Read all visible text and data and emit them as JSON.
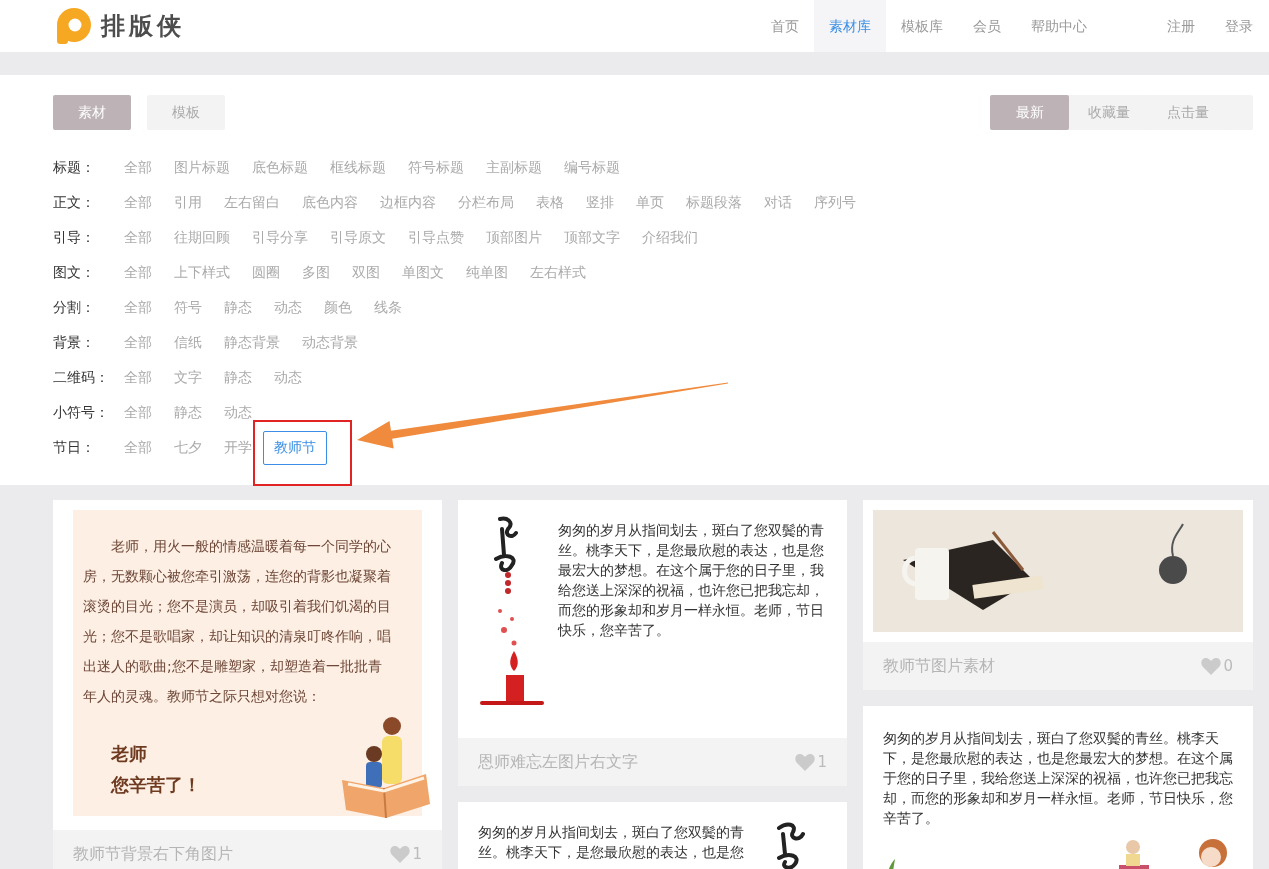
{
  "header": {
    "logo_text": "排版侠",
    "nav": [
      {
        "label": "首页",
        "selected": false
      },
      {
        "label": "素材库",
        "selected": true
      },
      {
        "label": "模板库",
        "selected": false
      },
      {
        "label": "会员",
        "selected": false
      },
      {
        "label": "帮助中心",
        "selected": false
      }
    ],
    "account_links": [
      "注册",
      "登录"
    ]
  },
  "type_tabs": [
    {
      "label": "素材",
      "selected": true
    },
    {
      "label": "模板",
      "selected": false
    }
  ],
  "sort_tabs": [
    {
      "label": "最新",
      "selected": true
    },
    {
      "label": "收藏量",
      "selected": false
    },
    {
      "label": "点击量",
      "selected": false
    }
  ],
  "filters": [
    {
      "label": "标题：",
      "options": [
        {
          "label": "全部",
          "selected": false
        },
        {
          "label": "图片标题",
          "selected": false
        },
        {
          "label": "底色标题",
          "selected": false
        },
        {
          "label": "框线标题",
          "selected": false
        },
        {
          "label": "符号标题",
          "selected": false
        },
        {
          "label": "主副标题",
          "selected": false
        },
        {
          "label": "编号标题",
          "selected": false
        }
      ]
    },
    {
      "label": "正文：",
      "options": [
        {
          "label": "全部",
          "selected": false
        },
        {
          "label": "引用",
          "selected": false
        },
        {
          "label": "左右留白",
          "selected": false
        },
        {
          "label": "底色内容",
          "selected": false
        },
        {
          "label": "边框内容",
          "selected": false
        },
        {
          "label": "分栏布局",
          "selected": false
        },
        {
          "label": "表格",
          "selected": false
        },
        {
          "label": "竖排",
          "selected": false
        },
        {
          "label": "单页",
          "selected": false
        },
        {
          "label": "标题段落",
          "selected": false
        },
        {
          "label": "对话",
          "selected": false
        },
        {
          "label": "序列号",
          "selected": false
        }
      ]
    },
    {
      "label": "引导：",
      "options": [
        {
          "label": "全部",
          "selected": false
        },
        {
          "label": "往期回顾",
          "selected": false
        },
        {
          "label": "引导分享",
          "selected": false
        },
        {
          "label": "引导原文",
          "selected": false
        },
        {
          "label": "引导点赞",
          "selected": false
        },
        {
          "label": "顶部图片",
          "selected": false
        },
        {
          "label": "顶部文字",
          "selected": false
        },
        {
          "label": "介绍我们",
          "selected": false
        }
      ]
    },
    {
      "label": "图文：",
      "options": [
        {
          "label": "全部",
          "selected": false
        },
        {
          "label": "上下样式",
          "selected": false
        },
        {
          "label": "圆圈",
          "selected": false
        },
        {
          "label": "多图",
          "selected": false
        },
        {
          "label": "双图",
          "selected": false
        },
        {
          "label": "单图文",
          "selected": false
        },
        {
          "label": "纯单图",
          "selected": false
        },
        {
          "label": "左右样式",
          "selected": false
        }
      ]
    },
    {
      "label": "分割：",
      "options": [
        {
          "label": "全部",
          "selected": false
        },
        {
          "label": "符号",
          "selected": false
        },
        {
          "label": "静态",
          "selected": false
        },
        {
          "label": "动态",
          "selected": false
        },
        {
          "label": "颜色",
          "selected": false
        },
        {
          "label": "线条",
          "selected": false
        }
      ]
    },
    {
      "label": "背景：",
      "options": [
        {
          "label": "全部",
          "selected": false
        },
        {
          "label": "信纸",
          "selected": false
        },
        {
          "label": "静态背景",
          "selected": false
        },
        {
          "label": "动态背景",
          "selected": false
        }
      ]
    },
    {
      "label": "二维码：",
      "options": [
        {
          "label": "全部",
          "selected": false
        },
        {
          "label": "文字",
          "selected": false
        },
        {
          "label": "静态",
          "selected": false
        },
        {
          "label": "动态",
          "selected": false
        }
      ]
    },
    {
      "label": "小符号：",
      "options": [
        {
          "label": "全部",
          "selected": false
        },
        {
          "label": "静态",
          "selected": false
        },
        {
          "label": "动态",
          "selected": false
        }
      ]
    },
    {
      "label": "节日：",
      "options": [
        {
          "label": "全部",
          "selected": false
        },
        {
          "label": "七夕",
          "selected": false
        },
        {
          "label": "开学",
          "selected": false
        },
        {
          "label": "教师节",
          "selected": true
        }
      ]
    }
  ],
  "card_columns": [
    {
      "cards": [
        {
          "kind": "background_text",
          "text": "老师，用火一般的情感温暖着每一个同学的心房，无数颗心被您牵引激荡，连您的背影也凝聚着滚烫的目光；您不是演员，却吸引着我们饥渴的目光；您不是歌唱家，却让知识的清泉叮咚作响，唱出迷人的歌曲;您不是雕塑家，却塑造着一批批青年人的灵魂。教师节之际只想对您说：",
          "closing": [
            "老师",
            "您辛苦了！"
          ],
          "title": "教师节背景右下角图片",
          "likes": "1"
        }
      ]
    },
    {
      "cards": [
        {
          "kind": "image_left",
          "text": "匆匆的岁月从指间划去，斑白了您双鬓的青丝。桃李天下，是您最欣慰的表达，也是您最宏大的梦想。在这个属于您的日子里，我给您送上深深的祝福，也许您已把我忘却，而您的形象却和岁月一样永恒。老师，节日快乐，您辛苦了。",
          "title": "恩师难忘左图片右文字",
          "likes": "1"
        },
        {
          "kind": "image_right",
          "text": "匆匆的岁月从指间划去，斑白了您双鬓的青丝。桃李天下，是您最欣慰的表达，也是您"
        }
      ]
    },
    {
      "cards": [
        {
          "kind": "image",
          "title": "教师节图片素材",
          "likes": "0"
        },
        {
          "kind": "text_above_image",
          "text": "匆匆的岁月从指间划去，斑白了您双鬓的青丝。桃李天下，是您最欣慰的表达，也是您最宏大的梦想。在这个属于您的日子里，我给您送上深深的祝福，也许您已把我忘却，而您的形象却和岁月一样永恒。老师，节日快乐，您辛苦了。"
        }
      ]
    }
  ]
}
